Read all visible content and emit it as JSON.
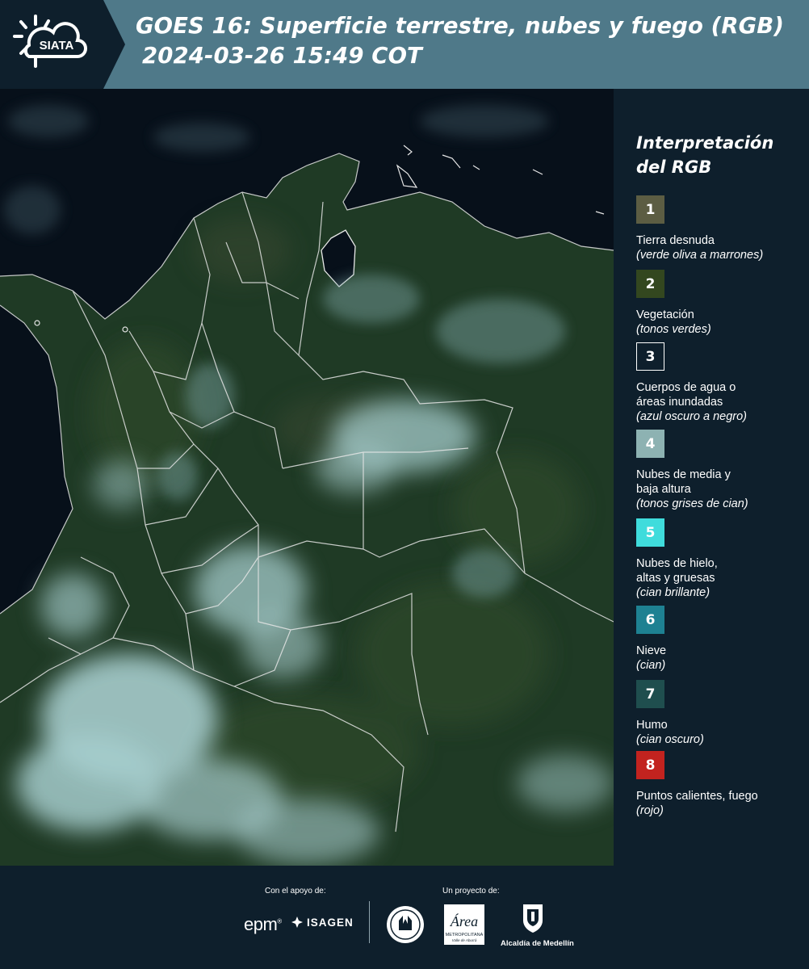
{
  "header": {
    "logo_text": "SIATA",
    "title_line1": "GOES 16: Superficie terrestre, nubes y fuego (RGB)",
    "title_line2": "2024-03-26 15:49 COT"
  },
  "legend": {
    "title_line1": "Interpretación",
    "title_line2": "del RGB",
    "items": [
      {
        "number": "1",
        "color": "#5c5d43",
        "label": "Tierra desnuda",
        "note": "(verde oliva a marrones)"
      },
      {
        "number": "2",
        "color": "#33471f",
        "label": "Vegetación",
        "note": "(tonos verdes)"
      },
      {
        "number": "3",
        "color": "#0e1f2c",
        "label": "Cuerpos de agua o\náreas inundadas",
        "note": "(azul oscuro a negro)"
      },
      {
        "number": "4",
        "color": "#8db2b2",
        "label": "Nubes de media y\nbaja altura",
        "note": "(tonos grises de cian)"
      },
      {
        "number": "5",
        "color": "#3fdcdc",
        "label": "Nubes de hielo,\naltas y gruesas",
        "note": "(cian brillante)"
      },
      {
        "number": "6",
        "color": "#1e8192",
        "label": "Nieve",
        "note": "(cian)"
      },
      {
        "number": "7",
        "color": "#1f4e4e",
        "label": "Humo",
        "note": "(cian oscuro)"
      },
      {
        "number": "8",
        "color": "#c2231f",
        "label": "Puntos calientes, fuego",
        "note": "(rojo)"
      }
    ]
  },
  "footer": {
    "support_label": "Con el apoyo de:",
    "project_label": "Un proyecto de:",
    "epm": "epm",
    "isagen": "ISAGEN",
    "area_name": "Área",
    "area_sub": "METROPOLITANA",
    "area_sub2": "Valle de Aburrá",
    "alcaldia": "Alcaldía de Medellín"
  },
  "colors": {
    "header_bg": "#4f7989",
    "panel_bg": "#0e1f2c",
    "ocean": "#07101a",
    "land": "#1f3823",
    "cloud": "#9fc9c9"
  }
}
